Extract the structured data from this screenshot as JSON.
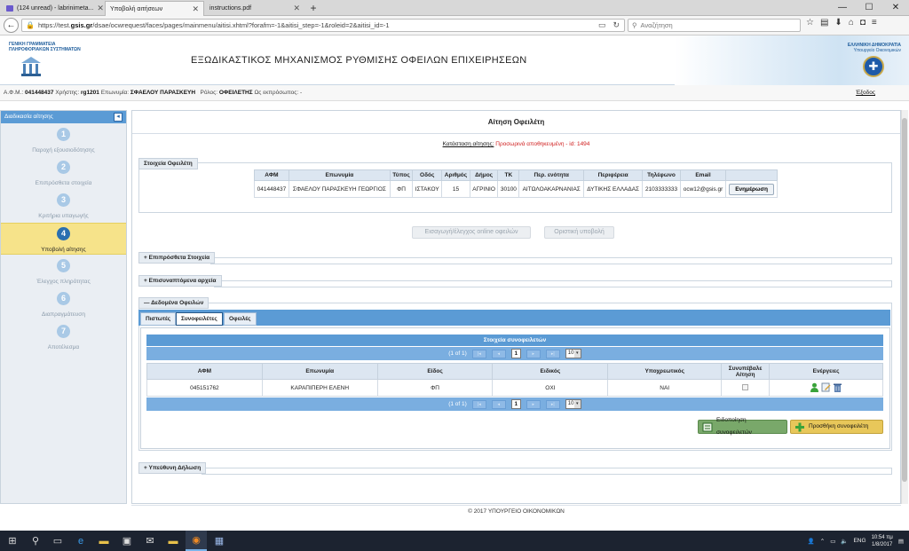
{
  "browser": {
    "tabs": [
      {
        "label": "(124 unread) - labrinimeta...",
        "active": false
      },
      {
        "label": "Υποβολή αιτήσεων",
        "active": true
      },
      {
        "label": "instructions.pdf",
        "active": false
      }
    ],
    "url_prefix": "https://test.",
    "url_host": "gsis.gr",
    "url_rest": "/dsae/ocwrequest/faces/pages/mainmenu/aitisi.xhtml?forafm=-1&aitisi_step=-1&roleid=2&aitisi_id=-1",
    "search_placeholder": "Αναζήτηση"
  },
  "header": {
    "gsis_label": "ΓΕΝΙΚΗ ΓΡΑΜΜΑΤΕΙΑ ΠΛΗΡΟΦΟΡΙΑΚΩΝ ΣΥΣΤΗΜΑΤΩΝ",
    "title": "ΕΞΩΔΙΚΑΣΤΙΚΟΣ ΜΗΧΑΝΙΣΜΟΣ ΡΥΘΜΙΣΗΣ ΟΦΕΙΛΩΝ ΕΠΙΧΕΙΡΗΣΕΩΝ",
    "ministry_line1": "ΕΛΛΗΝΙΚΗ ΔΗΜΟΚΡΑΤΙΑ",
    "ministry_line2": "Υπουργείο Οικονομικών"
  },
  "userbar": {
    "afm_label": "Α.Φ.Μ.:",
    "afm": "041448437",
    "user_label": "Χρήστης:",
    "user": "rg1201",
    "name_label": "Επωνυμία:",
    "name": "ΣΦΑΕΛΟΥ ΠΑΡΑΣΚΕΥΗ",
    "role_label": "Ρόλος:",
    "role": "ΟΦΕΙΛΕΤΗΣ",
    "rep_label": "Ως εκπρόσωπος:",
    "rep": "-",
    "logout": "Έξοδος"
  },
  "sidebar": {
    "header": "Διαδικασία αίτησης",
    "steps": [
      {
        "num": "1",
        "label": "Παροχή εξουσιοδότησης"
      },
      {
        "num": "2",
        "label": "Επιπρόσθετα στοιχεία"
      },
      {
        "num": "3",
        "label": "Κριτήρια υπαγωγής"
      },
      {
        "num": "4",
        "label": "Υποβολή αίτησης"
      },
      {
        "num": "5",
        "label": "Έλεγχος πληρότητας"
      },
      {
        "num": "6",
        "label": "Διαπραγμάτευση"
      },
      {
        "num": "7",
        "label": "Αποτέλεσμα"
      }
    ]
  },
  "main": {
    "title": "Αίτηση Οφειλέτη",
    "status_label": "Κατάσταση αίτησης:",
    "status_value": "Προσωρινά αποθηκευμένη - id: 1494",
    "debtor_section": "Στοιχεία Οφειλέτη",
    "debtor_table": {
      "headers": [
        "ΑΦΜ",
        "Επωνυμία",
        "Τύπος",
        "Οδός",
        "Αριθμός",
        "Δήμος",
        "ΤΚ",
        "Περ. ενότητα",
        "Περιφέρεια",
        "Τηλέφωνο",
        "Email"
      ],
      "row": [
        "041448437",
        "ΣΦΑΕΛΟΥ ΠΑΡΑΣΚΕΥΗ ΓΕΩΡΓΙΟΣ",
        "ΦΠ",
        "ΙΣΤΑΚΟΥ",
        "15",
        "ΑΓΡΙΝΙΟ",
        "30100",
        "ΑΙΤΩΛΟΑΚΑΡΝΑΝΙΑΣ",
        "ΔΥΤΙΚΗΣ ΕΛΛΑΔΑΣ",
        "2103333333",
        "ocw12@gsis.gr"
      ],
      "update_button": "Ενημέρωση"
    },
    "import_button": "Εισαγωγή/έλεγχος online οφειλών",
    "final_submit_button": "Οριστική υποβολή",
    "section_additional": "Επιπρόσθετα Στοιχεία",
    "section_attachments": "Επισυναπτόμενα αρχεία",
    "section_debts": "Δεδομένα Οφειλών",
    "debt_tabs": [
      "Πιστωτές",
      "Συνοφειλέτες",
      "Οφειλές"
    ],
    "grid": {
      "caption": "Στοιχεία συνοφειλετών",
      "pager_text": "(1 of 1)",
      "page": "1",
      "page_size": "10",
      "headers": [
        "ΑΦΜ",
        "Επωνυμία",
        "Είδος",
        "Ειδικός",
        "Υποχρεωτικός",
        "Συνυπέβαλε Αίτηση",
        "Ενέργειες"
      ],
      "row": [
        "045151762",
        "ΚΑΡΑΠΙΠΕΡΗ ΕΛΕΝΗ",
        "ΦΠ",
        "ΟΧΙ",
        "ΝΑΙ"
      ]
    },
    "notify_button": "Ειδοποίηση συνοφειλετών",
    "add_button": "Προσθήκη συνοφειλέτη",
    "section_declaration": "Υπεύθυνη Δήλωση",
    "footer": "© 2017 ΥΠΟΥΡΓΕΙΟ ΟΙΚΟΝΟΜΙΚΩΝ"
  },
  "taskbar": {
    "lang": "ENG",
    "time": "10:54 πμ",
    "date": "1/8/2017"
  },
  "colors": {
    "accent": "#5b9bd5",
    "active_step": "#f6e38a",
    "status_red": "#d02020"
  }
}
